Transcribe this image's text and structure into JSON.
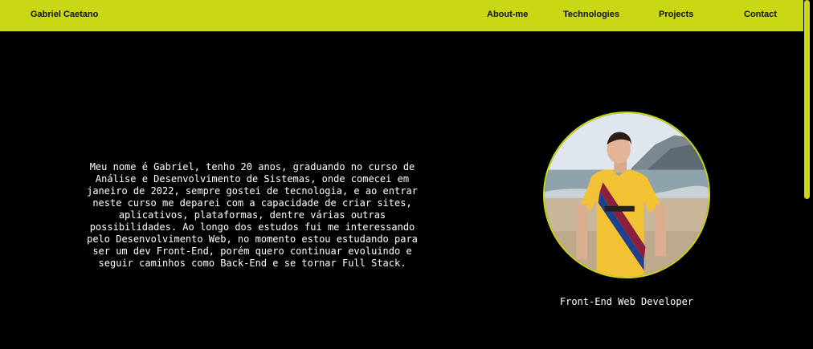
{
  "nav": {
    "brand": "Gabriel Caetano",
    "links": [
      "About-me",
      "Technologies",
      "Projects",
      "Contact"
    ]
  },
  "about": {
    "text": "Meu nome é Gabriel, tenho 20 anos, graduando no curso de Análise e Desenvolvimento de Sistemas, onde comecei em janeiro de 2022, sempre gostei de tecnologia, e ao entrar neste curso me deparei com a capacidade de criar sites, aplicativos, plataformas, dentre várias outras possibilidades. Ao longo dos estudos fui me interessando pelo Desenvolvimento Web, no momento estou estudando para ser um dev Front-End, porém quero continuar evoluindo e seguir caminhos como Back-End e se tornar Full Stack."
  },
  "profile": {
    "role": "Front-End Web Developer"
  },
  "colors": {
    "accent": "#c9d714",
    "background": "#000000",
    "text": "#ffffff"
  }
}
